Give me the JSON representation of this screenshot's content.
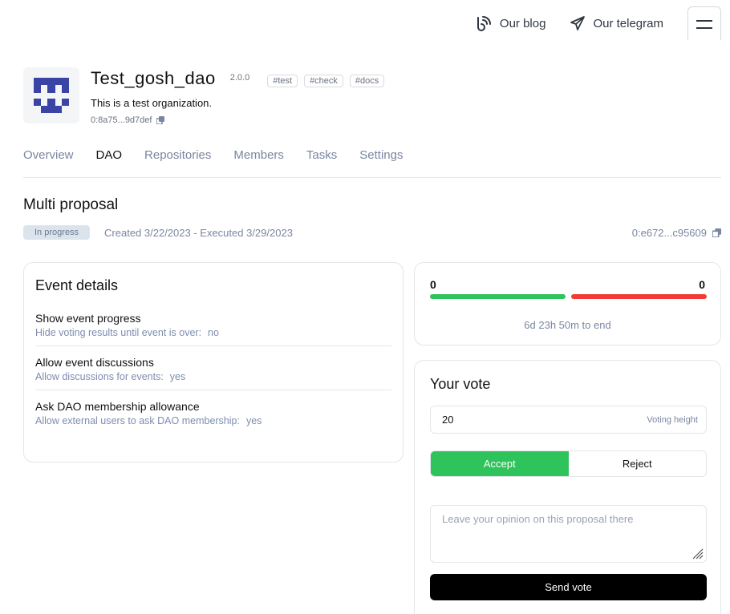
{
  "topnav": {
    "blog_label": "Our blog",
    "telegram_label": "Our telegram"
  },
  "dao": {
    "name": "Test_gosh_dao",
    "version": "2.0.0",
    "tags": [
      "#test",
      "#check",
      "#docs"
    ],
    "description": "This is a test organization.",
    "address": "0:8a75...9d7def"
  },
  "tabs": [
    "Overview",
    "DAO",
    "Repositories",
    "Members",
    "Tasks",
    "Settings"
  ],
  "active_tab": "DAO",
  "proposal": {
    "title": "Multi proposal",
    "status": "In progress",
    "dates": "Created 3/22/2023 - Executed 3/29/2023",
    "address": "0:e672...c95609"
  },
  "event_details": {
    "title": "Event details",
    "items": [
      {
        "title": "Show event progress",
        "label": "Hide voting results until event is over:",
        "value": "no"
      },
      {
        "title": "Allow event discussions",
        "label": "Allow discussions for events:",
        "value": "yes"
      },
      {
        "title": "Ask DAO membership allowance",
        "label": "Allow external users to ask DAO membership:",
        "value": "yes"
      }
    ]
  },
  "results": {
    "accept_count": "0",
    "reject_count": "0",
    "time_left": "6d 23h 50m to end"
  },
  "vote": {
    "title": "Your vote",
    "height_value": "20",
    "height_label": "Voting height",
    "accept_label": "Accept",
    "reject_label": "Reject",
    "comment_placeholder": "Leave your opinion on this proposal there",
    "send_label": "Send vote"
  },
  "colors": {
    "accept": "#2fc35b",
    "reject": "#f13c35",
    "logo": "#3a43a6"
  }
}
